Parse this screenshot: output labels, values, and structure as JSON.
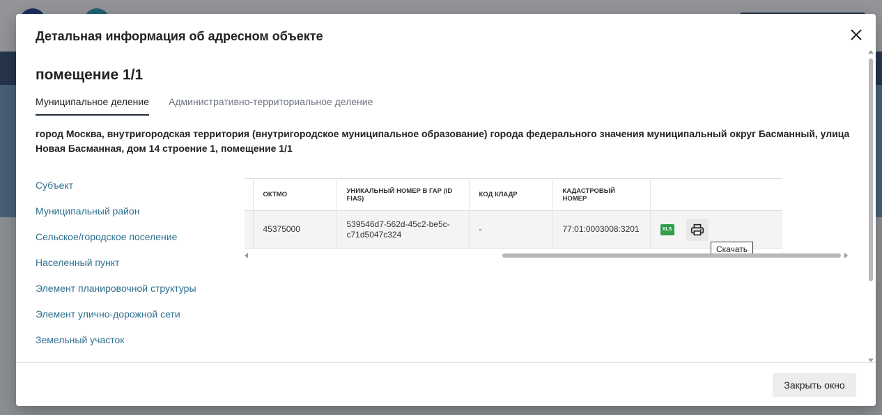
{
  "modal": {
    "title": "Детальная информация об адресном объекте",
    "object_title": "помещение 1/1",
    "tabs": [
      {
        "label": "Муниципальное деление",
        "active": true
      },
      {
        "label": "Административно-территориальное деление",
        "active": false
      }
    ],
    "address": "город Москва, внутригородская территория (внутригородское муниципальное образование) города федерального значения муниципальный округ Басманный, улица Новая Басманная, дом 14 строение 1, помещение 1/1",
    "side_items": [
      "Субъект",
      "Муниципальный район",
      "Сельское/городское поселение",
      "Населенный пункт",
      "Элемент планировочной структуры",
      "Элемент улично-дорожной сети",
      "Земельный участок"
    ],
    "table": {
      "headers": [
        "ОКТМО",
        "Уникальный номер в ГАР (ID FIAS)",
        "Код КЛАДР",
        "Кадастровый номер"
      ],
      "row": [
        "45375000",
        "539546d7-562d-45c2-be5c-c71d5047c324",
        "-",
        "77:01:0003008:3201"
      ],
      "xls_label": "XLS"
    },
    "tooltip": "Скачать",
    "close_button": "Закрыть окно"
  },
  "colors": {
    "link": "#2e6f8e",
    "xls_green": "#2f9e48",
    "overlay": "#1c2028"
  }
}
